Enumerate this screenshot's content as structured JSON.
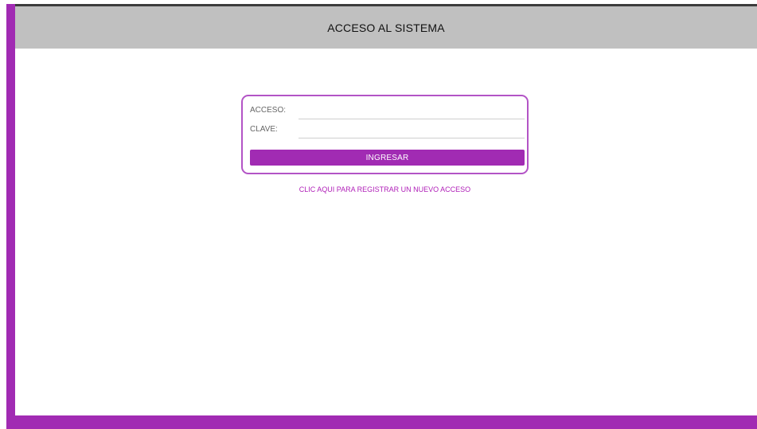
{
  "header": {
    "title": "ACCESO AL SISTEMA"
  },
  "login": {
    "user_label": "ACCESO:",
    "user_value": "",
    "password_label": "CLAVE:",
    "password_value": "",
    "submit_label": "INGRESAR"
  },
  "register": {
    "link_label": "CLIC AQUI PARA REGISTRAR UN NUEVO ACCESO"
  },
  "colors": {
    "accent": "#a12bb3",
    "header_bg": "#c0c0c0",
    "box_border": "#b354c6"
  }
}
